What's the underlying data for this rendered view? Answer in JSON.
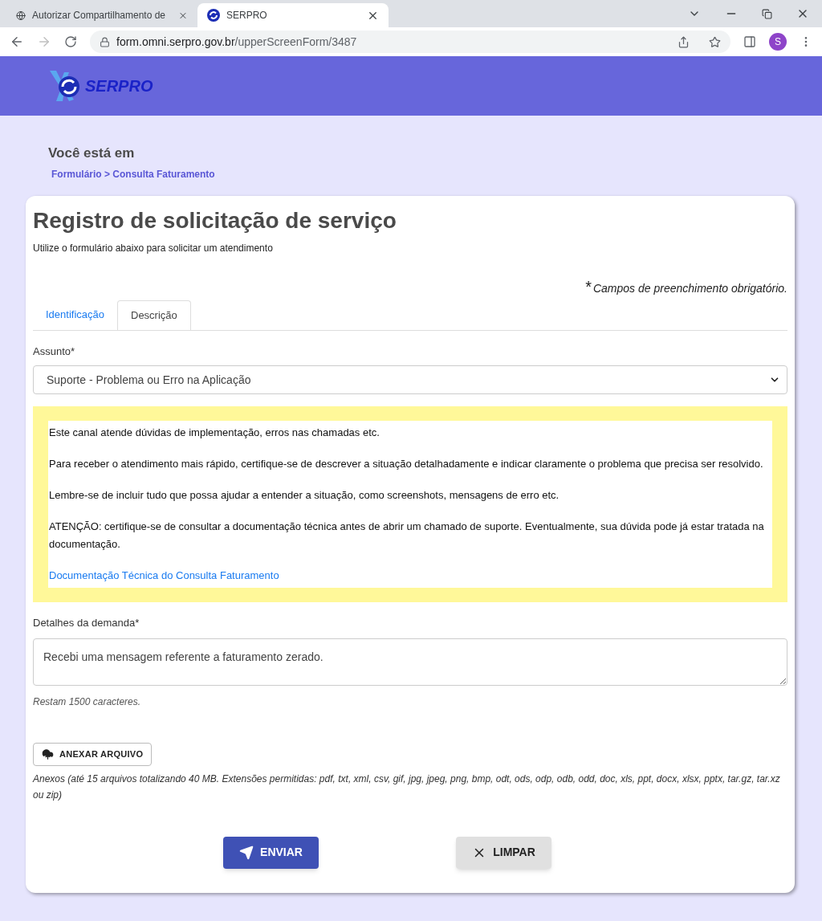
{
  "browser": {
    "tabs": [
      {
        "title": "Autorizar Compartilhamento de",
        "selected": false
      },
      {
        "title": "SERPRO",
        "selected": true
      }
    ],
    "url": {
      "host": "form.omni.serpro.gov.br",
      "path": "/upperScreenForm/3487"
    },
    "profile": "S"
  },
  "header": {
    "logo": "SERPRO"
  },
  "breadcrumb": {
    "title": "Você está em",
    "path": "Formulário > Consulta Faturamento"
  },
  "form": {
    "title": "Registro de solicitação de serviço",
    "subtitle": "Utilize o formulário abaixo para solicitar um atendimento",
    "required_mark": "*",
    "required_note": "Campos de preenchimento obrigatório.",
    "tabs": [
      {
        "label": "Identificação",
        "selected": false
      },
      {
        "label": "Descrição",
        "selected": true
      }
    ],
    "subject": {
      "label": "Assunto*",
      "value": "Suporte - Problema ou Erro na Aplicação"
    },
    "info": {
      "paragraphs": [
        "Este canal atende dúvidas de implementação, erros nas chamadas etc.",
        "Para receber o atendimento mais rápido, certifique-se de descrever a situação detalhadamente e indicar claramente o problema que precisa ser resolvido.",
        "Lembre-se de incluir tudo que possa ajudar a entender a situação, como screenshots, mensagens de erro etc.",
        "ATENÇÃO: certifique-se de consultar a documentação técnica antes de abrir um chamado de suporte. Eventualmente, sua dúvida pode já estar tratada na documentação."
      ],
      "link": "Documentação Técnica do Consulta Faturamento"
    },
    "details": {
      "label": "Detalhes da demanda*",
      "value": "Recebi uma mensagem referente a faturamento zerado.",
      "remaining": "Restam 1500 caracteres."
    },
    "attach": {
      "button": "ANEXAR ARQUIVO",
      "note": "Anexos (até 15 arquivos totalizando 40 MB. Extensões permitidas: pdf, txt, xml, csv, gif, jpg, jpeg, png, bmp, odt, ods, odp, odb, odd, doc, xls, ppt, docx, xlsx, pptx, tar.gz, tar.xz ou zip)"
    },
    "buttons": [
      {
        "kind": "submit",
        "label": "ENVIAR"
      },
      {
        "kind": "clear",
        "label": "LIMPAR"
      }
    ]
  }
}
